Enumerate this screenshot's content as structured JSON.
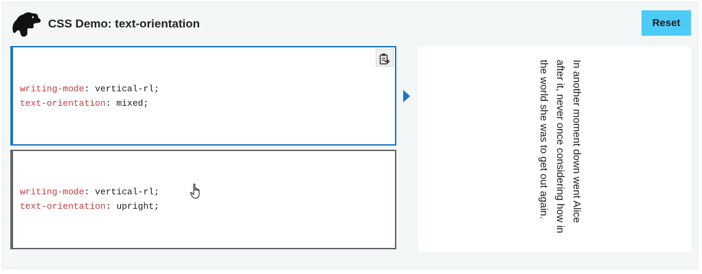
{
  "header": {
    "title": "CSS Demo: text-orientation",
    "reset_label": "Reset",
    "logo_icon": "dinosaur-logo-icon"
  },
  "examples": [
    {
      "state": "selected",
      "lines": [
        {
          "property": "writing-mode",
          "value": "vertical-rl"
        },
        {
          "property": "text-orientation",
          "value": "mixed"
        }
      ]
    },
    {
      "state": "unselected",
      "lines": [
        {
          "property": "writing-mode",
          "value": "vertical-rl"
        },
        {
          "property": "text-orientation",
          "value": "upright"
        }
      ]
    }
  ],
  "copy_icon": "clipboard-copy-icon",
  "output": {
    "text": "In another moment down went Alice after it, never once considering how in the world she was to get out again."
  },
  "colors": {
    "accent": "#1b76c4",
    "reset_button": "#4ccbf7",
    "property": "#c83a3a",
    "inactive_border": "#636363",
    "background": "#f4f7f8"
  }
}
